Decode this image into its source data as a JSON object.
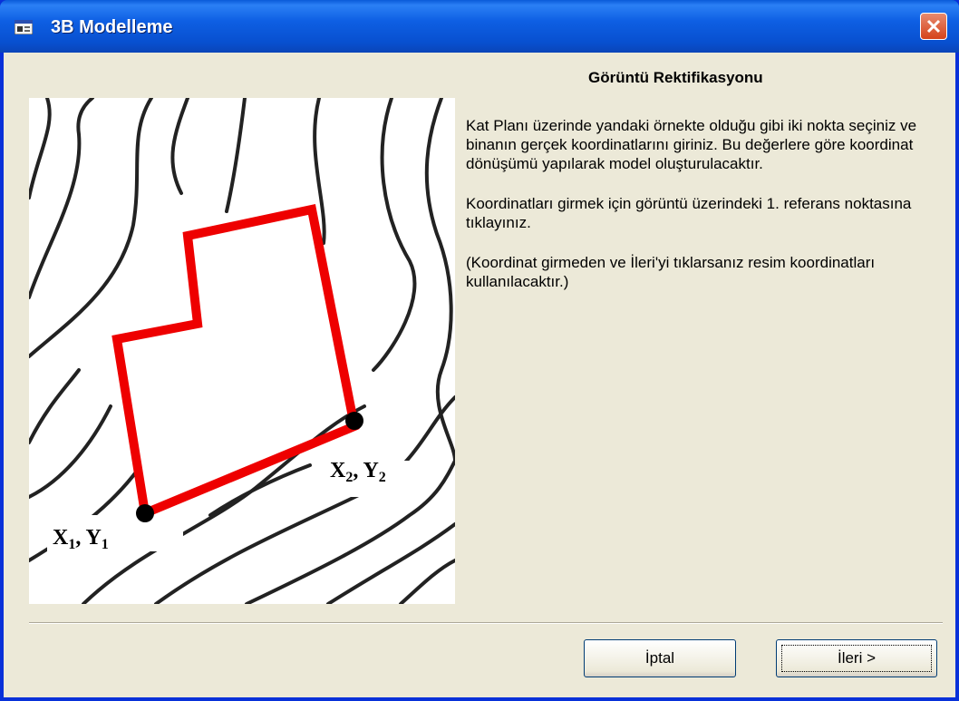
{
  "window": {
    "title": "3B Modelleme"
  },
  "heading": "Görüntü Rektifikasyonu",
  "description": [
    "Kat Planı üzerinde yandaki örnekte olduğu gibi iki nokta seçiniz ve binanın gerçek koordinatlarını giriniz. Bu değerlere göre koordinat dönüşümü yapılarak model oluşturulacaktır.",
    "Koordinatları girmek için görüntü üzerindeki 1. referans noktasına tıklayınız.",
    "(Koordinat girmeden ve İleri'yi tıklarsanız resim koordinatları kullanılacaktır.)"
  ],
  "illustration": {
    "point1": {
      "x": "X",
      "x_sub": "1",
      "sep": ", ",
      "y": "Y",
      "y_sub": "1"
    },
    "point2": {
      "x": "X",
      "x_sub": "2",
      "sep": ", ",
      "y": "Y",
      "y_sub": "2"
    },
    "outline_color": "#ee0000"
  },
  "buttons": {
    "cancel": "İptal",
    "next": "İleri >"
  },
  "icons": {
    "app": "window-app-icon",
    "close": "close-icon"
  }
}
